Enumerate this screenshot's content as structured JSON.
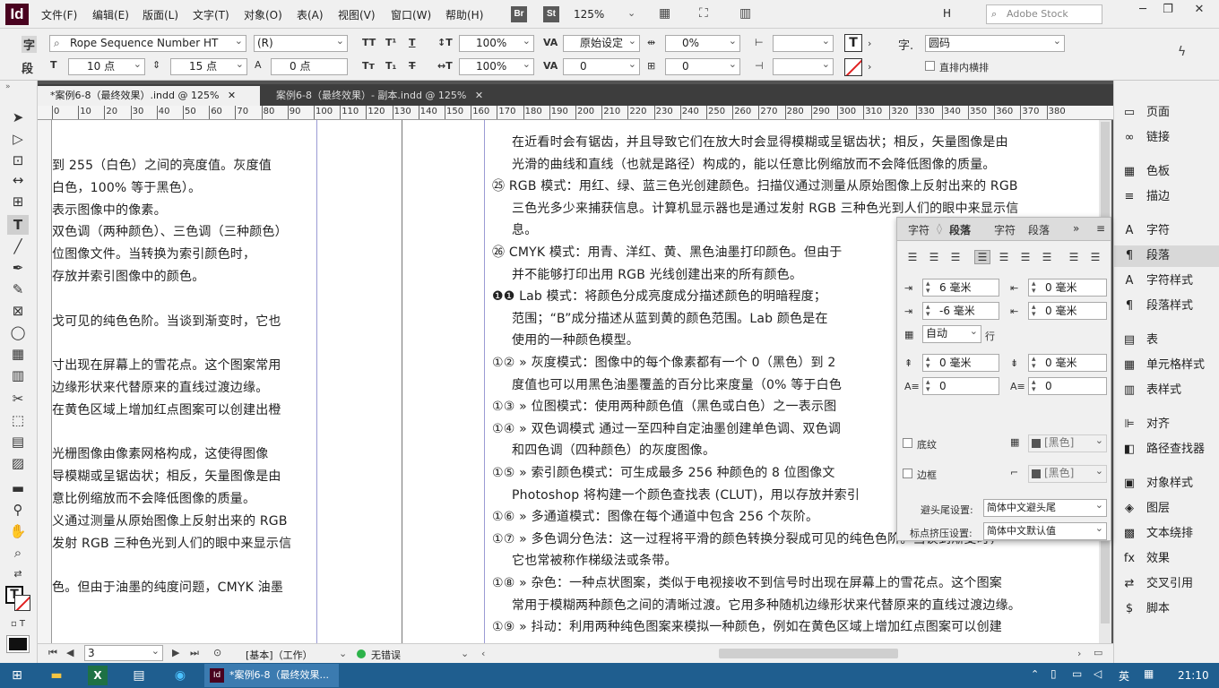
{
  "menubar": {
    "logo": "Id",
    "items": [
      "文件(F)",
      "编辑(E)",
      "版面(L)",
      "文字(T)",
      "对象(O)",
      "表(A)",
      "视图(V)",
      "窗口(W)",
      "帮助(H)"
    ],
    "bridge": "Br",
    "stock_icon": "St",
    "zoom": "125%",
    "workspace": "H",
    "search_placeholder": "Adobe Stock",
    "win_min": "─",
    "win_restore": "❐",
    "win_close": "✕"
  },
  "control": {
    "char_btn": "字",
    "para_btn": "段",
    "font": "Rope Sequence Number HT",
    "style": "(R)",
    "size": "10 点",
    "leading": "15 点",
    "baseline": "0 点",
    "hscale": "100%",
    "vscale": "100%",
    "kern": "原始设定",
    "track": "0",
    "tsume": "0%",
    "shift": "0",
    "grid": "0",
    "lang": "圆码",
    "tate": "直排内横排"
  },
  "tabs": [
    {
      "label": "*案例6-8（最终效果）.indd @ 125%",
      "close": "✕"
    },
    {
      "label": "案例6-8（最终效果）- 副本.indd @ 125%",
      "close": "✕"
    }
  ],
  "ruler_ticks": [
    "0",
    "10",
    "20",
    "30",
    "40",
    "50",
    "60",
    "70",
    "80",
    "90",
    "100",
    "110",
    "120",
    "130",
    "140",
    "150",
    "160",
    "170",
    "180",
    "190",
    "200",
    "210",
    "220",
    "230",
    "240",
    "250",
    "260",
    "270",
    "280",
    "290",
    "300",
    "310",
    "320",
    "330",
    "340",
    "350",
    "360",
    "370",
    "380"
  ],
  "left_lines": [
    "到 255（白色）之间的亮度值。灰度值",
    "白色，100% 等于黑色）。",
    "表示图像中的像素。",
    "双色调（两种颜色）、三色调（三种颜色）",
    "位图像文件。当转换为索引颜色时，",
    "存放并索引图像中的颜色。",
    "",
    "戈可见的纯色色阶。当谈到渐变时，它也",
    "",
    "寸出现在屏幕上的雪花点。这个图案常用",
    "边缘形状来代替原来的直线过渡边缘。",
    "在黄色区域上增加红点图案可以创建出橙",
    "",
    "光栅图像由像素网格构成，这使得图像",
    "导模糊或呈锯齿状；相反，矢量图像是由",
    "意比例缩放而不会降低图像的质量。",
    "义通过测量从原始图像上反射出来的 RGB",
    "发射 RGB 三种色光到人们的眼中来显示信",
    "",
    "色。但由于油墨的纯度问题，CMYK 油墨"
  ],
  "right_lines": [
    {
      "t": "在近看时会有锯齿，并且导致它们在放大时会显得模糊或呈锯齿状；相反，矢量图像是由"
    },
    {
      "t": "光滑的曲线和直线（也就是路径）构成的，能以任意比例缩放而不会降低图像的质量。"
    },
    {
      "t": "㉕ RGB 模式：用红、绿、蓝三色光创建颜色。扫描仪通过测量从原始图像上反射出来的 RGB"
    },
    {
      "t": "三色光多少来捕获信息。计算机显示器也是通过发射 RGB 三种色光到人们的眼中来显示信"
    },
    {
      "t": "息。"
    },
    {
      "t": "㉖ CMYK 模式：用青、洋红、黄、黑色油墨打印颜色。但由于"
    },
    {
      "t": "并不能够打印出用 RGB 光线创建出来的所有颜色。"
    },
    {
      "t": "❶❶  Lab 模式：将颜色分成亮度成分描述颜色的明暗程度；"
    },
    {
      "t": "范围；“B”成分描述从蓝到黄的颜色范围。Lab 颜色是在"
    },
    {
      "t": "使用的一种颜色模型。"
    },
    {
      "t": "①②  » 灰度模式：图像中的每个像素都有一个 0（黑色）到 2"
    },
    {
      "t": "度值也可以用黑色油墨覆盖的百分比来度量（0% 等于白色"
    },
    {
      "t": "①③  » 位图模式：使用两种颜色值（黑色或白色）之一表示图"
    },
    {
      "t": "①④  » 双色调模式 通过一至四种自定油墨创建单色调、双色调"
    },
    {
      "t": "和四色调（四种颜色）的灰度图像。"
    },
    {
      "t": "①⑤  » 索引颜色模式：可生成最多 256 种颜色的 8 位图像文"
    },
    {
      "t": "Photoshop 将构建一个颜色查找表 (CLUT)，用以存放并索引"
    },
    {
      "t": "①⑥  » 多通道模式：图像在每个通道中包含 256 个灰阶。"
    },
    {
      "t": "①⑦  » 多色调分色法：这一过程将平滑的颜色转换分裂成可见的纯色色阶。当谈到渐变时，"
    },
    {
      "t": "它也常被称作梯级法或条带。"
    },
    {
      "t": "①⑧  » 杂色：一种点状图案，类似于电视接收不到信号时出现在屏幕上的雪花点。这个图案"
    },
    {
      "t": "常用于模糊两种颜色之间的清晰过渡。它用多种随机边缘形状来代替原来的直线过渡边缘。"
    },
    {
      "t": "①⑨  » 抖动：利用两种纯色图案来模拟一种颜色，例如在黄色区域上增加红点图案可以创建"
    }
  ],
  "para_panel": {
    "tabs": [
      "字符",
      "段落",
      "字符",
      "段落"
    ],
    "left_indent": "6 毫米",
    "right_indent": "0 毫米",
    "first_indent": "-6 毫米",
    "last_indent": "0 毫米",
    "grid_align": "自动",
    "grid_unit": "行",
    "space_before": "0 毫米",
    "space_after": "0 毫米",
    "dropcap_lines": "0",
    "dropcap_chars": "0",
    "shading": "底纹",
    "border": "边框",
    "shading_color": "[黑色]",
    "border_color": "[黑色]",
    "kinsoku_label": "避头尾设置:",
    "kinsoku": "简体中文避头尾",
    "mojikumi_label": "标点挤压设置:",
    "mojikumi": "简体中文默认值"
  },
  "right_panel": [
    {
      "label": "页面",
      "icon": "page-icon",
      "g": "▭"
    },
    {
      "label": "链接",
      "icon": "link-icon",
      "g": "∞"
    },
    {
      "label": "色板",
      "icon": "swatch-icon",
      "g": "▦"
    },
    {
      "label": "描边",
      "icon": "stroke-icon",
      "g": "≡"
    },
    {
      "label": "字符",
      "icon": "char-icon",
      "g": "A"
    },
    {
      "label": "段落",
      "icon": "para-icon",
      "g": "¶"
    },
    {
      "label": "字符样式",
      "icon": "charstyle-icon",
      "g": "A"
    },
    {
      "label": "段落样式",
      "icon": "parastyle-icon",
      "g": "¶"
    },
    {
      "label": "表",
      "icon": "table-icon",
      "g": "▤"
    },
    {
      "label": "单元格样式",
      "icon": "cellstyle-icon",
      "g": "▦"
    },
    {
      "label": "表样式",
      "icon": "tablestyle-icon",
      "g": "▥"
    },
    {
      "label": "对齐",
      "icon": "align-icon",
      "g": "⊫"
    },
    {
      "label": "路径查找器",
      "icon": "pathfinder-icon",
      "g": "◧"
    },
    {
      "label": "对象样式",
      "icon": "objstyle-icon",
      "g": "▣"
    },
    {
      "label": "图层",
      "icon": "layers-icon",
      "g": "◈"
    },
    {
      "label": "文本绕排",
      "icon": "wrap-icon",
      "g": "▩"
    },
    {
      "label": "效果",
      "icon": "fx-icon",
      "g": "fx"
    },
    {
      "label": "交叉引用",
      "icon": "xref-icon",
      "g": "⇄"
    },
    {
      "label": "脚本",
      "icon": "script-icon",
      "g": "$"
    }
  ],
  "status": {
    "page": "3",
    "mode": "[基本]（工作）",
    "preflight": "无错误"
  },
  "taskbar": {
    "app": "*案例6-8（最终效果...",
    "ime": "英",
    "time": "21:10"
  }
}
